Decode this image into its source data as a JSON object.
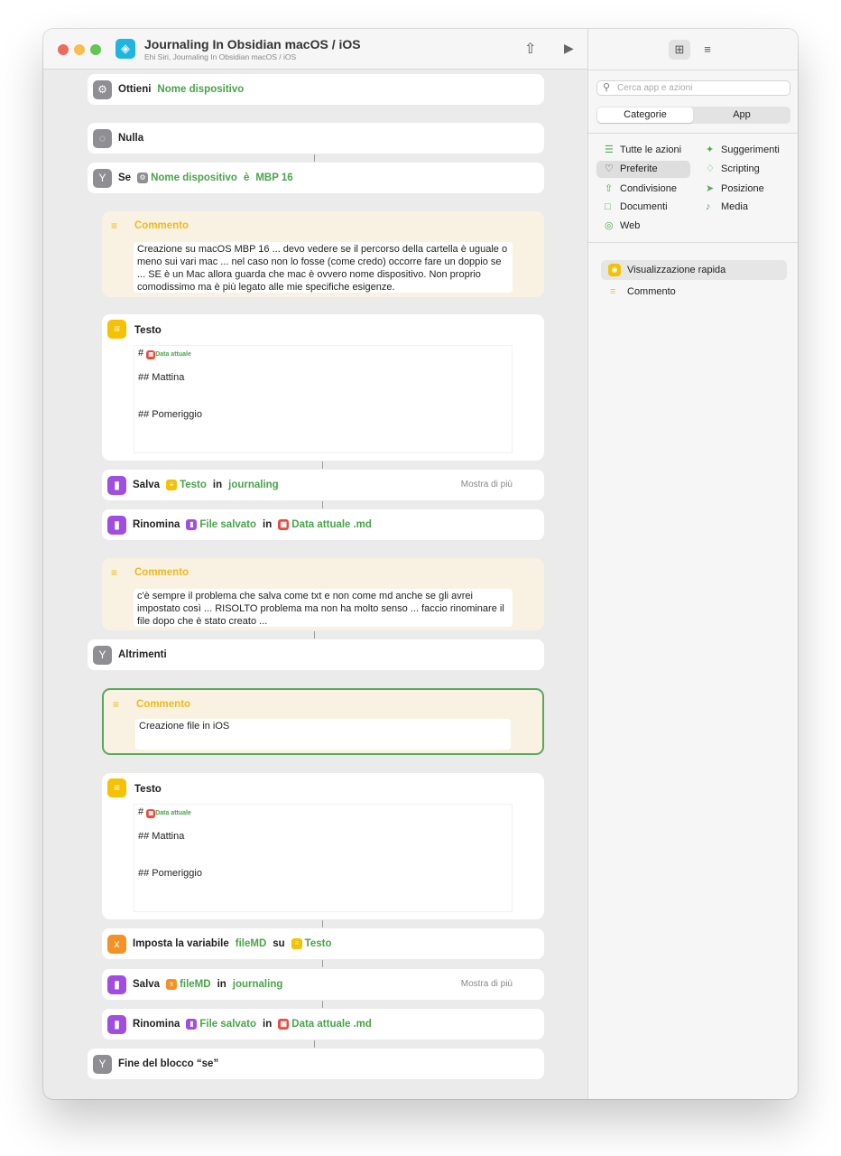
{
  "window": {
    "title": "Journaling In Obsidian macOS / iOS",
    "subtitle": "Ehi Siri, Journaling In Obsidian macOS / iOS",
    "icons": {
      "app": "shortcuts-app-icon",
      "share": "share-icon",
      "run": "play-icon"
    }
  },
  "actions": {
    "get": {
      "label": "Ottieni",
      "value": "Nome dispositivo"
    },
    "nothing": {
      "label": "Nulla"
    },
    "if": {
      "label": "Se",
      "token": "Nome dispositivo",
      "op": "è",
      "value": "MBP 16"
    },
    "comment1": {
      "title": "Commento",
      "text": "Creazione su macOS MBP 16 ... devo vedere se il percorso della cartella è uguale o meno sui vari mac ... nel caso non lo fosse (come credo) occorre fare un doppio se ... SE è un Mac allora guarda che mac è ovvero nome dispositivo. Non proprio comodissimo ma è più legato alle mie specifiche esigenze."
    },
    "text1": {
      "title": "Testo",
      "prefix": "#",
      "date_token": "Data attuale",
      "line1": "## Mattina",
      "line2": "## Pomeriggio"
    },
    "save1": {
      "label": "Salva",
      "token": "Testo",
      "in": "in",
      "folder": "journaling",
      "more": "Mostra di più"
    },
    "rename1": {
      "label": "Rinomina",
      "token": "File salvato",
      "in": "in",
      "date_token": "Data attuale",
      "suffix": ".md"
    },
    "comment2": {
      "title": "Commento",
      "text": "c'è sempre il problema che salva come txt e non come md anche se gli avrei impostato così ... RISOLTO problema ma non ha molto senso ... faccio rinominare il file dopo che è stato creato ..."
    },
    "otherwise": {
      "label": "Altrimenti"
    },
    "comment3": {
      "title": "Commento",
      "text": "Creazione file in iOS"
    },
    "text2": {
      "title": "Testo",
      "prefix": "#",
      "date_token": "Data attuale",
      "line1": "## Mattina",
      "line2": "## Pomeriggio"
    },
    "setvar": {
      "label": "Imposta la variabile",
      "var": "fileMD",
      "on": "su",
      "token": "Testo"
    },
    "save2": {
      "label": "Salva",
      "token": "fileMD",
      "in": "in",
      "folder": "journaling",
      "more": "Mostra di più"
    },
    "rename2": {
      "label": "Rinomina",
      "token": "File salvato",
      "in": "in",
      "date_token": "Data attuale",
      "suffix": ".md"
    },
    "endif": {
      "label": "Fine del blocco “se”"
    }
  },
  "sidebar": {
    "search_placeholder": "Cerca app e azioni",
    "segments": [
      "Categorie",
      "App"
    ],
    "categories": [
      "Tutte le azioni",
      "Suggerimenti",
      "Preferite",
      "Scripting",
      "Condivisione",
      "Posizione",
      "Documenti",
      "Media",
      "Web"
    ],
    "favorites": [
      "Visualizzazione rapida",
      "Commento"
    ]
  },
  "colors": {
    "green_token": "#49a34a",
    "comment_yellow": "#f0b81a",
    "accent_purple": "#a04ee0",
    "selected_border": "#57a85a"
  }
}
